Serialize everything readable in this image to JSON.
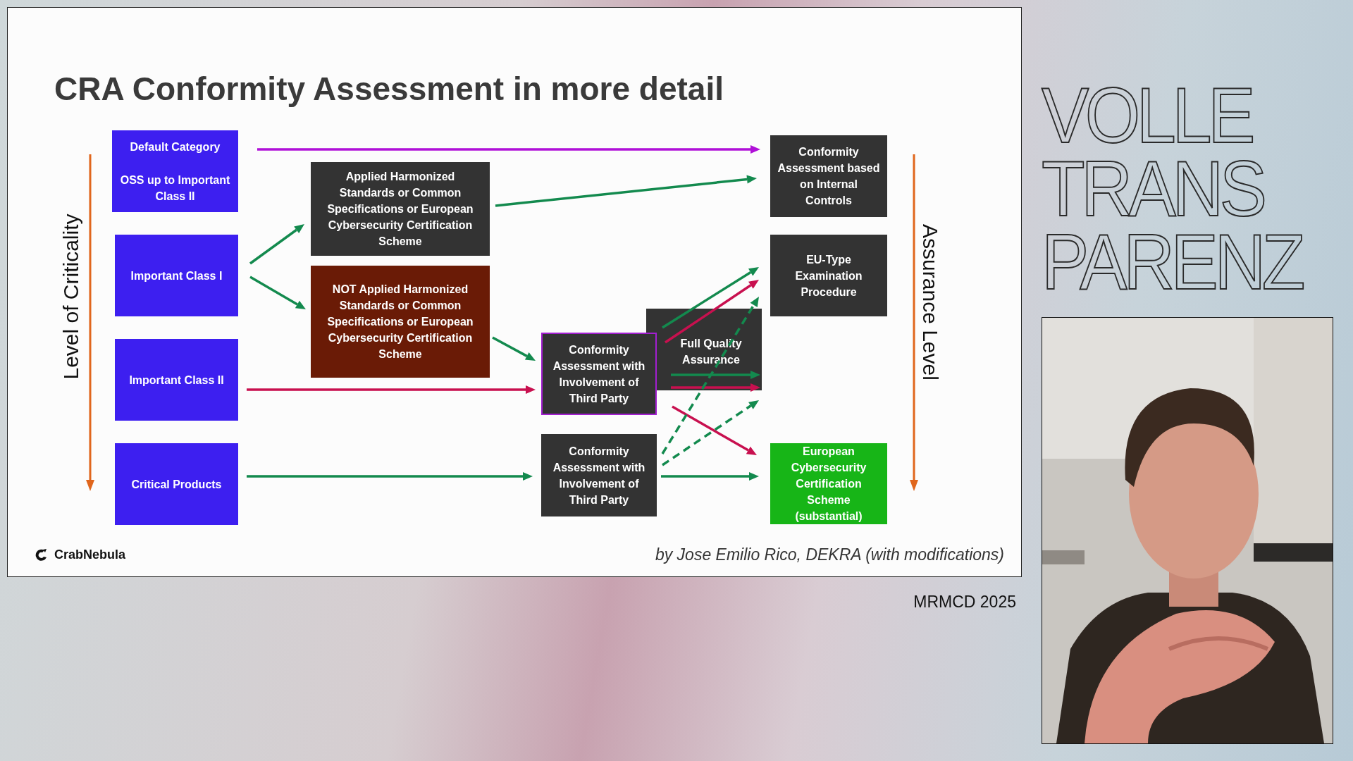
{
  "slide": {
    "title": "CRA Conformity Assessment in more detail",
    "axis_left": "Level of Criticality",
    "axis_right": "Assurance Level",
    "boxes": [
      {
        "kind": "category",
        "texts": [
          "Default Category",
          "OSS up to Important Class II"
        ]
      },
      {
        "kind": "process",
        "texts": [
          "Applied Harmonized Standards or Common Specifications or European Cybersecurity Certification Scheme"
        ]
      },
      {
        "kind": "process",
        "texts": [
          "Conformity Assessment based on Internal Controls"
        ]
      },
      {
        "kind": "category",
        "texts": [
          "Important Class I"
        ]
      },
      {
        "kind": "deviation",
        "texts": [
          "NOT Applied Harmonized Standards or Common Specifications or European Cybersecurity Certification Scheme"
        ]
      },
      {
        "kind": "process",
        "texts": [
          "EU-Type Examination Procedure"
        ]
      },
      {
        "kind": "category",
        "texts": [
          "Important Class II"
        ]
      },
      {
        "kind": "quality",
        "texts": [
          "Full Quality Assurance"
        ]
      },
      {
        "kind": "third-party",
        "texts": [
          "Conformity Assessment with Involvement of Third Party"
        ]
      },
      {
        "kind": "category",
        "texts": [
          "Critical Products"
        ]
      },
      {
        "kind": "process",
        "texts": [
          "Conformity Assessment with Involvement of Third Party"
        ]
      },
      {
        "kind": "certification",
        "texts": [
          "European Cybersecurity Certification Scheme (substantial)"
        ]
      }
    ],
    "logo": "CrabNebula",
    "credit": "by Jose Emilio Rico, DEKRA (with modifications)"
  },
  "event": "MRMCD 2025",
  "brand_lines": [
    "VOLLE",
    "TRANS",
    "PARENZ"
  ]
}
